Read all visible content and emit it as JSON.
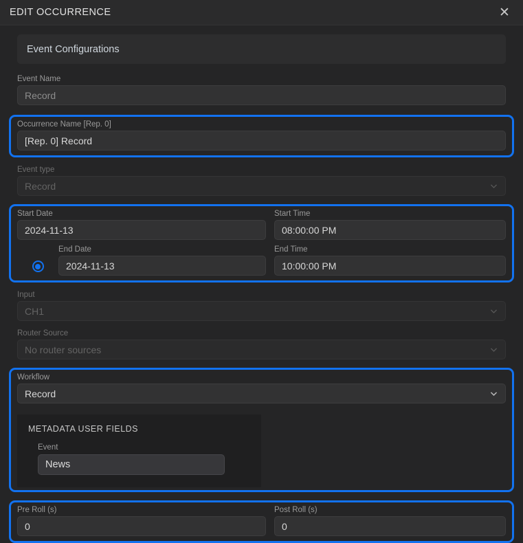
{
  "window": {
    "title": "EDIT OCCURRENCE",
    "close_icon": "close-icon",
    "accent_color": "#1272f0",
    "background_color": "#252526"
  },
  "section": {
    "title": "Event Configurations"
  },
  "fields": {
    "event_name": {
      "label": "Event Name",
      "value": "Record"
    },
    "occurrence_name": {
      "label": "Occurrence Name [Rep. 0]",
      "value": "[Rep. 0] Record"
    },
    "event_type": {
      "label": "Event type",
      "value": "Record",
      "icon": "chevron-down-icon"
    },
    "start_date": {
      "label": "Start Date",
      "value": "2024-11-13"
    },
    "end_date": {
      "label": "End Date",
      "value": "2024-11-13"
    },
    "start_time": {
      "label": "Start Time",
      "value": "08:00:00 PM"
    },
    "end_time": {
      "label": "End Time",
      "value": "10:00:00 PM"
    },
    "input": {
      "label": "Input",
      "value": "CH1",
      "icon": "chevron-down-icon"
    },
    "router_source": {
      "label": "Router Source",
      "value": "No router sources",
      "icon": "chevron-down-icon"
    },
    "workflow": {
      "label": "Workflow",
      "value": "Record",
      "icon": "chevron-down-icon"
    },
    "pre_roll": {
      "label": "Pre Roll (s)",
      "value": "0"
    },
    "post_roll": {
      "label": "Post Roll (s)",
      "value": "0"
    }
  },
  "metadata": {
    "title": "METADATA USER FIELDS",
    "event": {
      "label": "Event",
      "value": "News"
    }
  },
  "date_mode_radio": {
    "name": "date-range-radio",
    "selected": true
  }
}
